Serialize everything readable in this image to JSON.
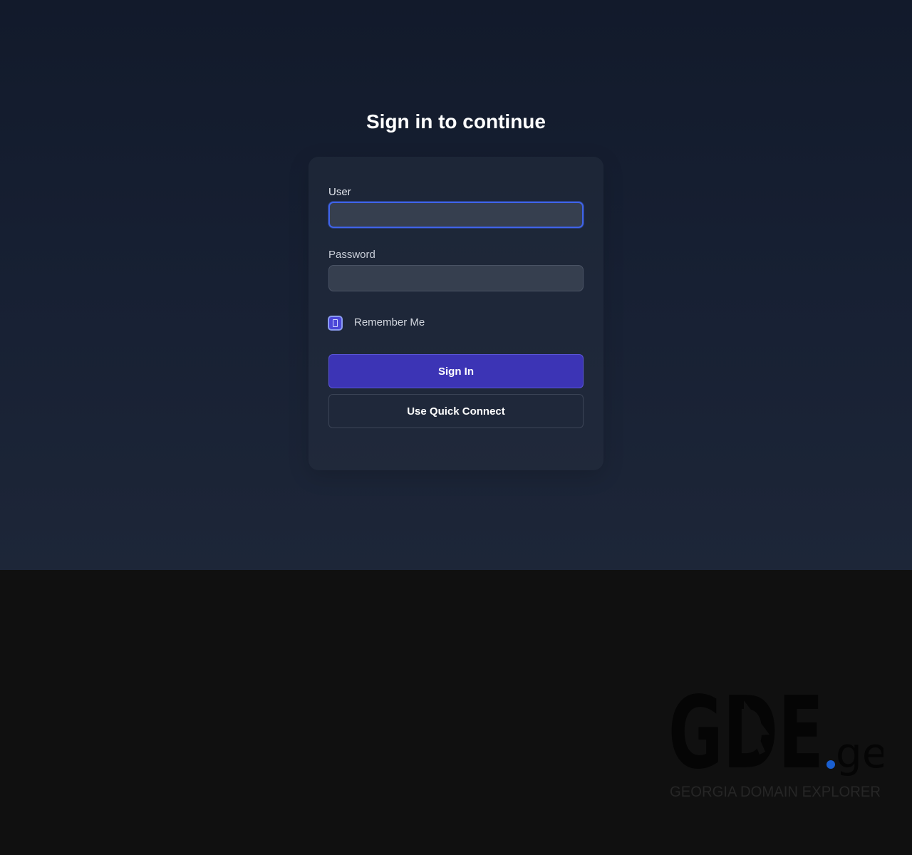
{
  "login": {
    "title": "Sign in to continue",
    "user_label": "User",
    "user_value": "",
    "password_label": "Password",
    "password_value": "",
    "remember_label": "Remember Me",
    "remember_checked": true,
    "sign_in_label": "Sign In",
    "quick_connect_label": "Use Quick Connect"
  },
  "logo": {
    "mark": "GDE",
    "suffix": ".ge",
    "tagline": "GEORGIA DOMAIN EXPLORER"
  },
  "colors": {
    "accent": "#3c34b5",
    "focus_ring": "#3f63e8",
    "logo_dot": "#1a5fd0"
  }
}
